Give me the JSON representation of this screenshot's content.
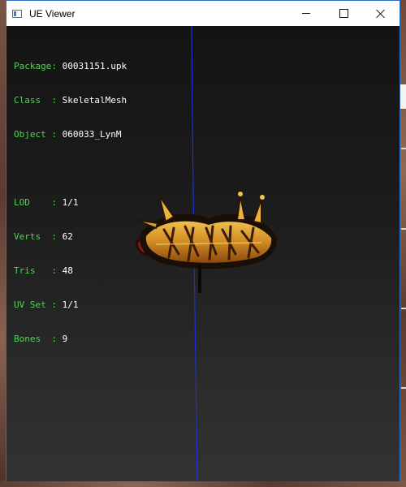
{
  "window": {
    "title": "UE Viewer",
    "controls": [
      "minimize",
      "maximize",
      "close"
    ]
  },
  "info_panel": {
    "group1": [
      {
        "label": "Package",
        "value": "00031151.upk"
      },
      {
        "label": "Class",
        "value": "SkeletalMesh"
      },
      {
        "label": "Object",
        "value": "060033_LynM"
      }
    ],
    "group2": [
      {
        "label": "LOD",
        "value": "1/1"
      },
      {
        "label": "Verts",
        "value": "62"
      },
      {
        "label": "Tris",
        "value": "48"
      },
      {
        "label": "UV Set",
        "value": "1/1"
      },
      {
        "label": "Bones",
        "value": "9"
      }
    ]
  },
  "colors": {
    "label": "#4fd64f",
    "value": "#ffffff",
    "axis": "#1f2fd6",
    "logo_gold": "#d79a2a",
    "logo_red": "#8a1c14"
  },
  "icons": {
    "app": "window-app-icon",
    "min": "minimize-icon",
    "max": "maximize-icon",
    "close": "close-icon"
  }
}
